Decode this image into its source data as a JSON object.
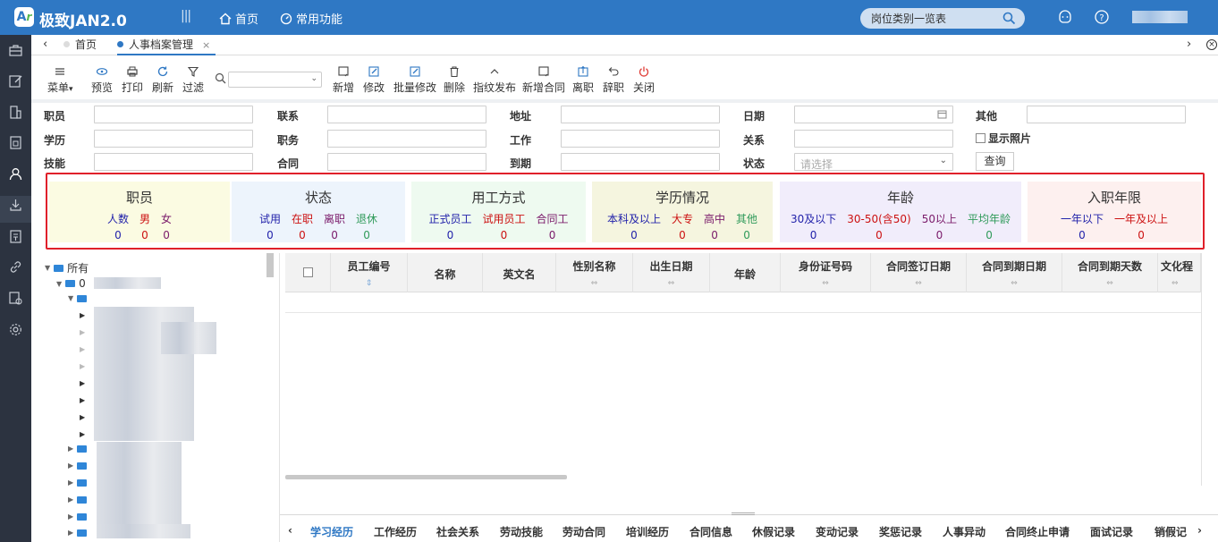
{
  "header": {
    "logo_text": "A",
    "app_title": "极致JAN2.0",
    "nav": [
      {
        "label": "首页"
      },
      {
        "label": "常用功能"
      }
    ],
    "search_value": "岗位类别一览表",
    "colors": {
      "topbar": "#2f78c4",
      "rail": "#2c3340",
      "accent": "#2f78c4",
      "highlight_border": "#e0202a"
    }
  },
  "tabs": [
    {
      "label": "首页",
      "active": false
    },
    {
      "label": "人事档案管理",
      "active": true,
      "close": "×"
    }
  ],
  "toolbar": {
    "left": [
      {
        "label": "菜单",
        "icon": "menu-icon"
      },
      {
        "label": "预览",
        "icon": "eye-icon"
      },
      {
        "label": "打印",
        "icon": "printer-icon"
      },
      {
        "label": "刷新",
        "icon": "refresh-icon"
      },
      {
        "label": "过滤",
        "icon": "filter-icon"
      }
    ],
    "right": [
      {
        "label": "新增",
        "icon": "add-icon"
      },
      {
        "label": "修改",
        "icon": "edit-icon"
      },
      {
        "label": "批量修改",
        "icon": "batch-edit-icon"
      },
      {
        "label": "删除",
        "icon": "trash-icon"
      },
      {
        "label": "指纹发布",
        "icon": "fingerprint-icon"
      },
      {
        "label": "新增合同",
        "icon": "contract-icon"
      },
      {
        "label": "离职",
        "icon": "leave-icon"
      },
      {
        "label": "辞职",
        "icon": "resign-icon"
      },
      {
        "label": "关闭",
        "icon": "power-icon"
      }
    ]
  },
  "filters": {
    "col1": [
      "职员",
      "学历",
      "技能"
    ],
    "col2": [
      "联系",
      "职务",
      "合同"
    ],
    "col3": [
      "地址",
      "工作",
      "到期"
    ],
    "col4": [
      "日期",
      "关系",
      "状态"
    ],
    "status_placeholder": "请选择",
    "other_label": "其他",
    "show_photo": "显示照片",
    "query": "查询"
  },
  "stats": [
    {
      "title": "职员",
      "bg": "#fbfbe2",
      "items": [
        {
          "label": "人数",
          "value": "0",
          "color": "#2222aa"
        },
        {
          "label": "男",
          "value": "0",
          "color": "#cc1111"
        },
        {
          "label": "女",
          "value": "0",
          "color": "#7a1a6a"
        }
      ]
    },
    {
      "title": "状态",
      "bg": "#edf4fc",
      "items": [
        {
          "label": "试用",
          "value": "0",
          "color": "#2222aa"
        },
        {
          "label": "在职",
          "value": "0",
          "color": "#cc1111"
        },
        {
          "label": "离职",
          "value": "0",
          "color": "#7a1a6a"
        },
        {
          "label": "退休",
          "value": "0",
          "color": "#2f9a5a"
        }
      ]
    },
    {
      "title": "用工方式",
      "bg": "#eefaf0",
      "items": [
        {
          "label": "正式员工",
          "value": "0",
          "color": "#2222aa"
        },
        {
          "label": "试用员工",
          "value": "0",
          "color": "#cc1111"
        },
        {
          "label": "合同工",
          "value": "0",
          "color": "#7a1a6a"
        }
      ]
    },
    {
      "title": "学历情况",
      "bg": "#f5f5df",
      "items": [
        {
          "label": "本科及以上",
          "value": "0",
          "color": "#2222aa"
        },
        {
          "label": "大专",
          "value": "0",
          "color": "#cc1111"
        },
        {
          "label": "高中",
          "value": "0",
          "color": "#7a1a6a"
        },
        {
          "label": "其他",
          "value": "0",
          "color": "#2f9a5a"
        }
      ]
    },
    {
      "title": "年龄",
      "bg": "#f1edfb",
      "items": [
        {
          "label": "30及以下",
          "value": "0",
          "color": "#2222aa"
        },
        {
          "label": "30-50(含50)",
          "value": "0",
          "color": "#cc1111"
        },
        {
          "label": "50以上",
          "value": "0",
          "color": "#7a1a6a"
        },
        {
          "label": "平均年龄",
          "value": "0",
          "color": "#2f9a5a"
        }
      ]
    },
    {
      "title": "入职年限",
      "bg": "#fdf0ef",
      "items": [
        {
          "label": "一年以下",
          "value": "0",
          "color": "#2222aa"
        },
        {
          "label": "一年及以上",
          "value": "0",
          "color": "#cc1111"
        }
      ]
    }
  ],
  "tree": {
    "root": "所有",
    "node_prefix": "0"
  },
  "grid": {
    "columns": [
      "员工编号",
      "名称",
      "英文名",
      "性别名称",
      "出生日期",
      "年龄",
      "身份证号码",
      "合同签订日期",
      "合同到期日期",
      "合同到期天数",
      "文化程"
    ]
  },
  "bottom_tabs": [
    "学习经历",
    "工作经历",
    "社会关系",
    "劳动技能",
    "劳动合同",
    "培训经历",
    "合同信息",
    "休假记录",
    "变动记录",
    "奖惩记录",
    "人事异动",
    "合同终止申请",
    "面试记录",
    "销假记"
  ]
}
